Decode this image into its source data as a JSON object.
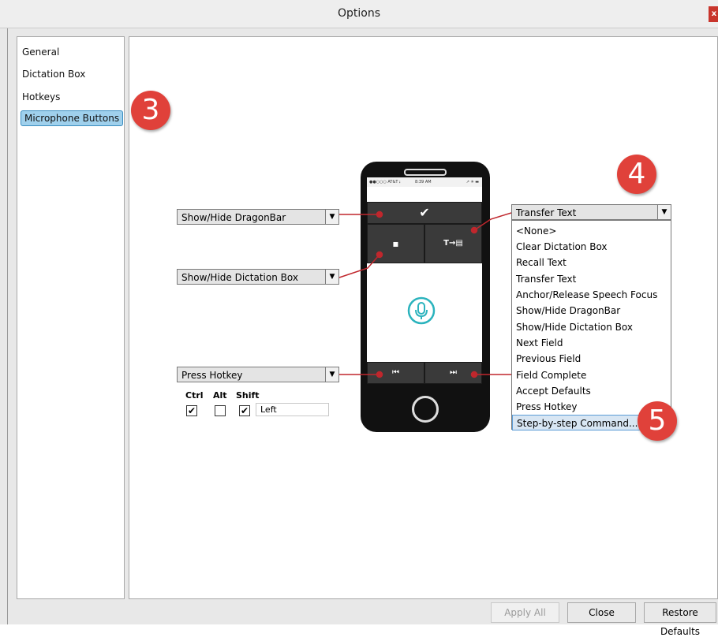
{
  "window": {
    "title": "Options",
    "close_label": "x"
  },
  "sidebar": {
    "items": [
      {
        "label": "General",
        "selected": false
      },
      {
        "label": "Dictation Box",
        "selected": false
      },
      {
        "label": "Hotkeys",
        "selected": false
      },
      {
        "label": "Microphone Buttons",
        "selected": true
      }
    ]
  },
  "phone": {
    "status": {
      "carrier": "●●○○○ AT&T ⨟",
      "time": "8:39 AM",
      "battery": "↗ ✳ ▬"
    },
    "icons": {
      "check": "✔",
      "message": "▪",
      "transfer": "T→▤",
      "prev": "⏮",
      "next": "⏭"
    }
  },
  "dropdowns": {
    "top": {
      "value": "Show/Hide DragonBar"
    },
    "middle": {
      "value": "Show/Hide Dictation Box"
    },
    "bottom": {
      "value": "Press Hotkey"
    },
    "right": {
      "value": "Transfer Text"
    },
    "arrow": "▼"
  },
  "right_list": {
    "options": [
      "<None>",
      "Clear Dictation Box",
      "Recall Text",
      "Transfer Text",
      "Anchor/Release Speech Focus",
      "Show/Hide DragonBar",
      "Show/Hide Dictation Box",
      "Next Field",
      "Previous Field",
      "Field Complete",
      "Accept Defaults",
      "Press Hotkey",
      "Step-by-step Command..."
    ],
    "selected": "Step-by-step Command..."
  },
  "hotkey": {
    "modifiers": [
      {
        "label": "Ctrl",
        "checked": true
      },
      {
        "label": "Alt",
        "checked": false
      },
      {
        "label": "Shift",
        "checked": true
      }
    ],
    "key": "Left",
    "check_glyph": "✔"
  },
  "badges": {
    "b3": "3",
    "b4": "4",
    "b5": "5"
  },
  "colors": {
    "accent": "#e0413a",
    "selected_bg": "#9fd0ec",
    "mic_teal": "#2bb3bd"
  },
  "buttons": {
    "apply_all": "Apply All",
    "close": "Close",
    "restore_defaults": "Restore Defaults"
  }
}
